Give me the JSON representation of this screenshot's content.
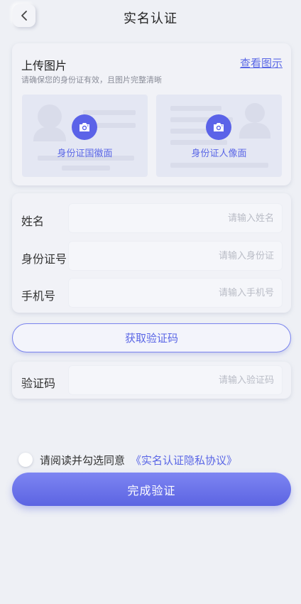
{
  "header": {
    "title": "实名认证",
    "back_icon": "chevron-left-icon"
  },
  "upload": {
    "title": "上传图片",
    "hint": "请确保您的身份证有效，且图片完整清晰",
    "view_sample": "查看图示",
    "slots": [
      {
        "label": "身份证国徽面",
        "icon": "camera-icon"
      },
      {
        "label": "身份证人像面",
        "icon": "camera-icon"
      }
    ]
  },
  "form": {
    "name": {
      "label": "姓名",
      "placeholder": "请输入姓名"
    },
    "id_number": {
      "label": "身份证号",
      "placeholder": "请输入身份证"
    },
    "phone": {
      "label": "手机号",
      "placeholder": "请输入手机号"
    }
  },
  "get_code_button": "获取验证码",
  "code": {
    "label": "验证码",
    "placeholder": "请输入验证码"
  },
  "agreement": {
    "text": "请阅读并勾选同意",
    "link": "《实名认证隐私协议》",
    "checked": false
  },
  "submit_button": "完成验证",
  "colors": {
    "accent": "#5b63e8",
    "background": "#eef0f5",
    "card": "#f1f2f7"
  }
}
